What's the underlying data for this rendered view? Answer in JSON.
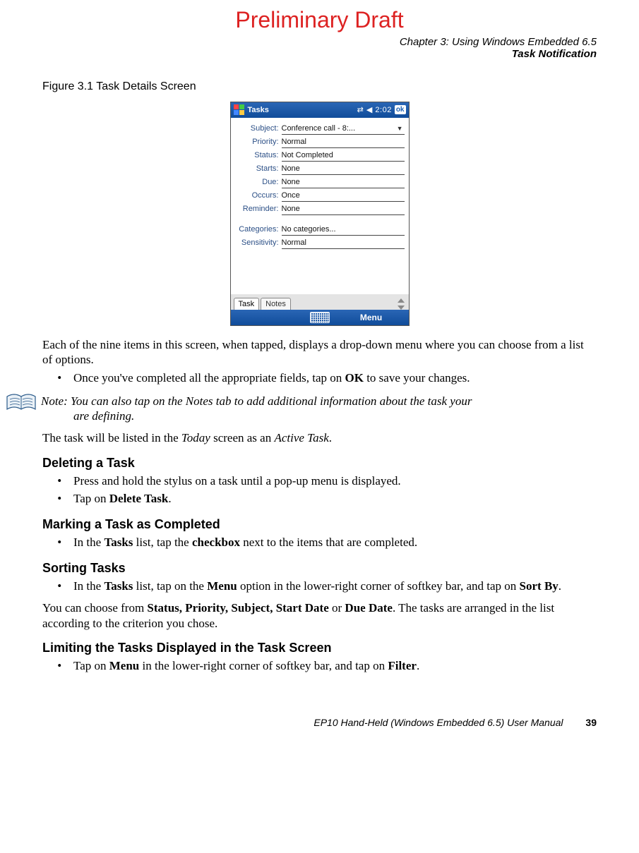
{
  "draft": "Preliminary Draft",
  "chapter_line": "Chapter 3:  Using Windows Embedded 6.5",
  "section_line": "Task Notification",
  "figure_caption": "Figure 3.1   Task Details Screen",
  "device": {
    "title": "Tasks",
    "clock": "⇄ ◀ 2:02",
    "ok": "ok",
    "rows": [
      {
        "label": "Subject:",
        "value": "Conference call - 8:...",
        "chev": true
      },
      {
        "label": "Priority:",
        "value": "Normal"
      },
      {
        "label": "Status:",
        "value": "Not Completed"
      },
      {
        "label": "Starts:",
        "value": "None"
      },
      {
        "label": "Due:",
        "value": "None"
      },
      {
        "label": "Occurs:",
        "value": "Once"
      },
      {
        "label": "Reminder:",
        "value": "None"
      }
    ],
    "rows2": [
      {
        "label": "Categories:",
        "value": "No categories..."
      },
      {
        "label": "Sensitivity:",
        "value": "Normal"
      }
    ],
    "tabs": [
      "Task",
      "Notes"
    ],
    "softkeys": {
      "left": "",
      "right": "Menu"
    }
  },
  "para_intro": "Each of the nine items in this screen, when tapped, displays a drop-down menu where you can choose from a list of options.",
  "bullet_ok_pre": "Once you've completed all the appropriate fields, tap on ",
  "bullet_ok_bold": "OK",
  "bullet_ok_post": " to save your changes.",
  "note_label": "Note: ",
  "note_line1": "You can also tap on the Notes tab to add additional information about the task your",
  "note_line2": "are defining.",
  "para_active_pre": "The task will be listed in the ",
  "para_active_i1": "Today",
  "para_active_mid": " screen as an ",
  "para_active_i2": "Active Task",
  "para_active_post": ".",
  "h_delete": "Deleting a Task",
  "del_b1": "Press and hold the stylus on a task until a pop-up menu is displayed.",
  "del_b2_pre": "Tap on ",
  "del_b2_bold": "Delete Task",
  "del_b2_post": ".",
  "h_mark": "Marking a Task as Completed",
  "mark_pre": "In the ",
  "mark_b1": "Tasks",
  "mark_mid": " list, tap the ",
  "mark_b2": "checkbox",
  "mark_post": " next to the items that are completed.",
  "h_sort": "Sorting Tasks",
  "sort_pre": "In the ",
  "sort_b1": "Tasks",
  "sort_mid1": " list, tap on the ",
  "sort_b2": "Menu",
  "sort_mid2": " option in the lower-right corner of softkey bar, and tap on ",
  "sort_b3": "Sort By",
  "sort_post": ".",
  "sort_para_pre": "You can choose from ",
  "sort_para_b1": "Status, Priority, Subject, Start Date",
  "sort_para_mid": " or ",
  "sort_para_b2": "Due Date",
  "sort_para_post": ". The tasks are arranged in the list according to the criterion you chose.",
  "h_limit": "Limiting the Tasks Displayed in the Task Screen",
  "lim_pre": "Tap on ",
  "lim_b1": "Menu",
  "lim_mid": " in the lower-right corner of softkey bar, and tap on ",
  "lim_b2": "Filter",
  "lim_post": ".",
  "footer_text": "EP10 Hand-Held (Windows Embedded 6.5) User Manual",
  "footer_page": "39"
}
